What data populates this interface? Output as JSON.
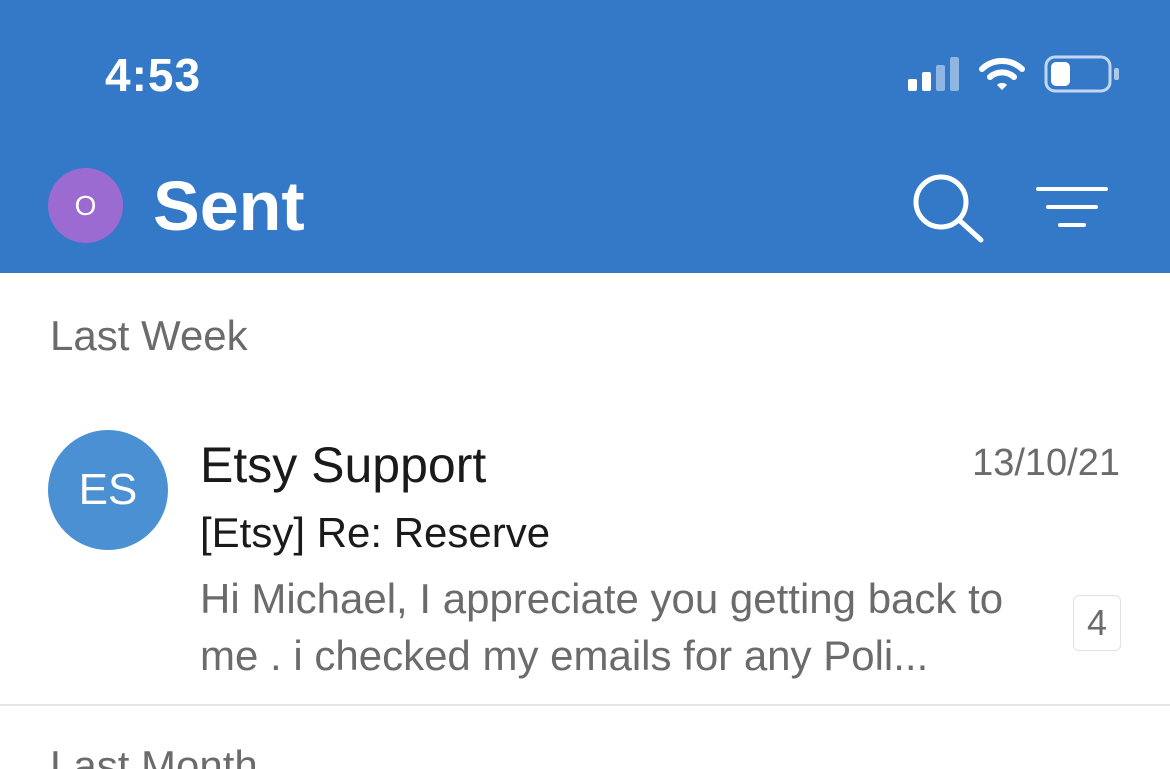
{
  "status_bar": {
    "time": "4:53",
    "icons": [
      "cellular-signal-icon",
      "wifi-icon",
      "battery-icon"
    ],
    "battery_level": 0.35
  },
  "header": {
    "account_initial": "O",
    "title": "Sent",
    "background_color": "#3478c8",
    "account_avatar_color": "#9b6bd1",
    "actions": [
      "search-icon",
      "filter-icon"
    ]
  },
  "sections": [
    {
      "label": "Last Week",
      "messages": [
        {
          "avatar_initials": "ES",
          "avatar_color": "#4a90d3",
          "sender": "Etsy Support",
          "date": "13/10/21",
          "subject": "[Etsy] Re: Reserve",
          "preview": "Hi Michael, I appreciate you getting back to me . i checked my emails for any Poli...",
          "thread_count": "4"
        }
      ]
    },
    {
      "label": "Last Month"
    }
  ]
}
